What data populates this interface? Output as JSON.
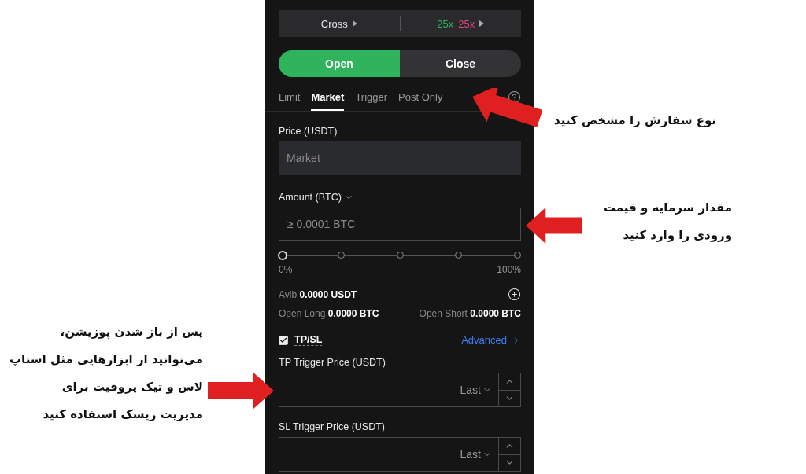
{
  "margin_bar": {
    "mode": "Cross",
    "leverage_long": "25x",
    "leverage_short": "25x"
  },
  "side_toggle": [
    {
      "label": "Open",
      "selected": true
    },
    {
      "label": "Close",
      "selected": false
    }
  ],
  "order_tabs": [
    {
      "label": "Limit",
      "selected": false
    },
    {
      "label": "Market",
      "selected": true
    },
    {
      "label": "Trigger",
      "selected": false
    },
    {
      "label": "Post Only",
      "selected": false
    }
  ],
  "price": {
    "label": "Price (USDT)",
    "placeholder": "Market"
  },
  "amount": {
    "label": "Amount (BTC)",
    "placeholder": "≥ 0.0001 BTC"
  },
  "slider": {
    "level": 0,
    "start_label": "0%",
    "end_label": "100%"
  },
  "available": {
    "label": "Avlb",
    "value": "0.0000 USDT"
  },
  "open_long": {
    "label": "Open Long",
    "value": "0.0000 BTC"
  },
  "open_short": {
    "label": "Open Short",
    "value": "0.0000 BTC"
  },
  "tpsl": {
    "label": "TP/SL",
    "checked": true,
    "advanced": "Advanced"
  },
  "trigger_fields": [
    {
      "label": "TP Trigger Price (USDT)",
      "price_type": "Last"
    },
    {
      "label": "SL Trigger Price (USDT)",
      "price_type": "Last"
    }
  ],
  "annotations": [
    {
      "text": "نوع سفارش را مشخص کنید"
    },
    {
      "text": "مقدار سرمایه و قیمت\nورودی را وارد کنید"
    },
    {
      "text": "پس از باز شدن پوزیشن،\nمی‌توانید از ابزارهایی مثل استاپ\nلاس و تیک پروفیت برای\nمدیریت ریسک استفاده کنید"
    }
  ]
}
